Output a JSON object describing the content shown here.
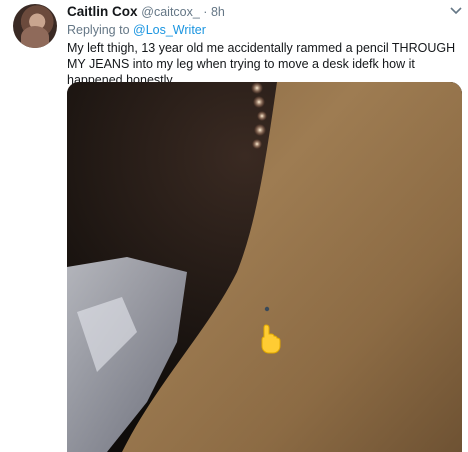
{
  "tweet": {
    "name": "Caitlin Cox",
    "handle": "@caitcox_",
    "separator": " · ",
    "time": "8h",
    "replying_prefix": "Replying to ",
    "replying_to": "@Los_Writer",
    "text": "My left thigh, 13 year old me accidentally rammed a pencil THROUGH MY JEANS into my leg when trying to move a desk idefk how it happened honestly"
  },
  "icons": {
    "avatar": "profile-avatar",
    "menu": "chevron-down-icon",
    "overlay": "pointing-hand-emoji"
  }
}
